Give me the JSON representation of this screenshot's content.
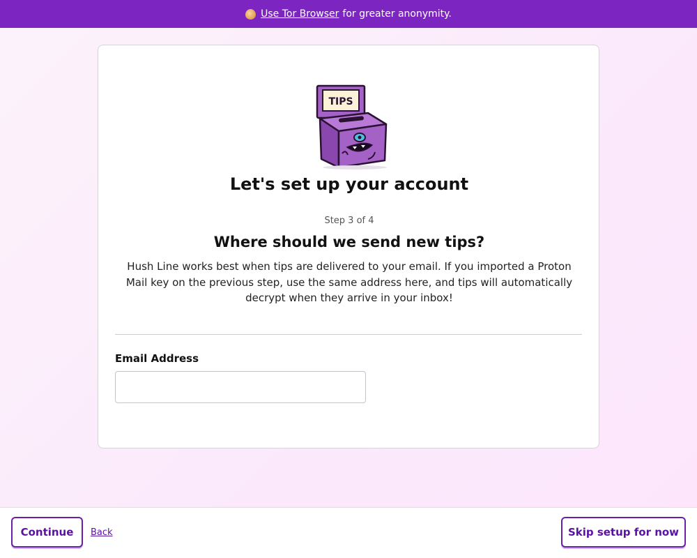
{
  "banner": {
    "link_text": "Use Tor Browser",
    "rest_text": "for greater anonymity.",
    "icon": "onion-icon"
  },
  "card": {
    "mascot_text": "TIPS",
    "title": "Let's set up your account",
    "step": "Step 3 of 4",
    "subtitle": "Where should we send new tips?",
    "description": "Hush Line works best when tips are delivered to your email. If you imported a Proton Mail key on the previous step, use the same address here, and tips will automatically decrypt when they arrive in your inbox!",
    "email_label": "Email Address",
    "email_value": "",
    "email_placeholder": ""
  },
  "footer": {
    "continue_label": "Continue",
    "back_label": "Back",
    "skip_label": "Skip setup for now"
  },
  "colors": {
    "banner": "#7d25c1",
    "accent": "#5a13a0",
    "mascot_body": "#a461c6"
  }
}
